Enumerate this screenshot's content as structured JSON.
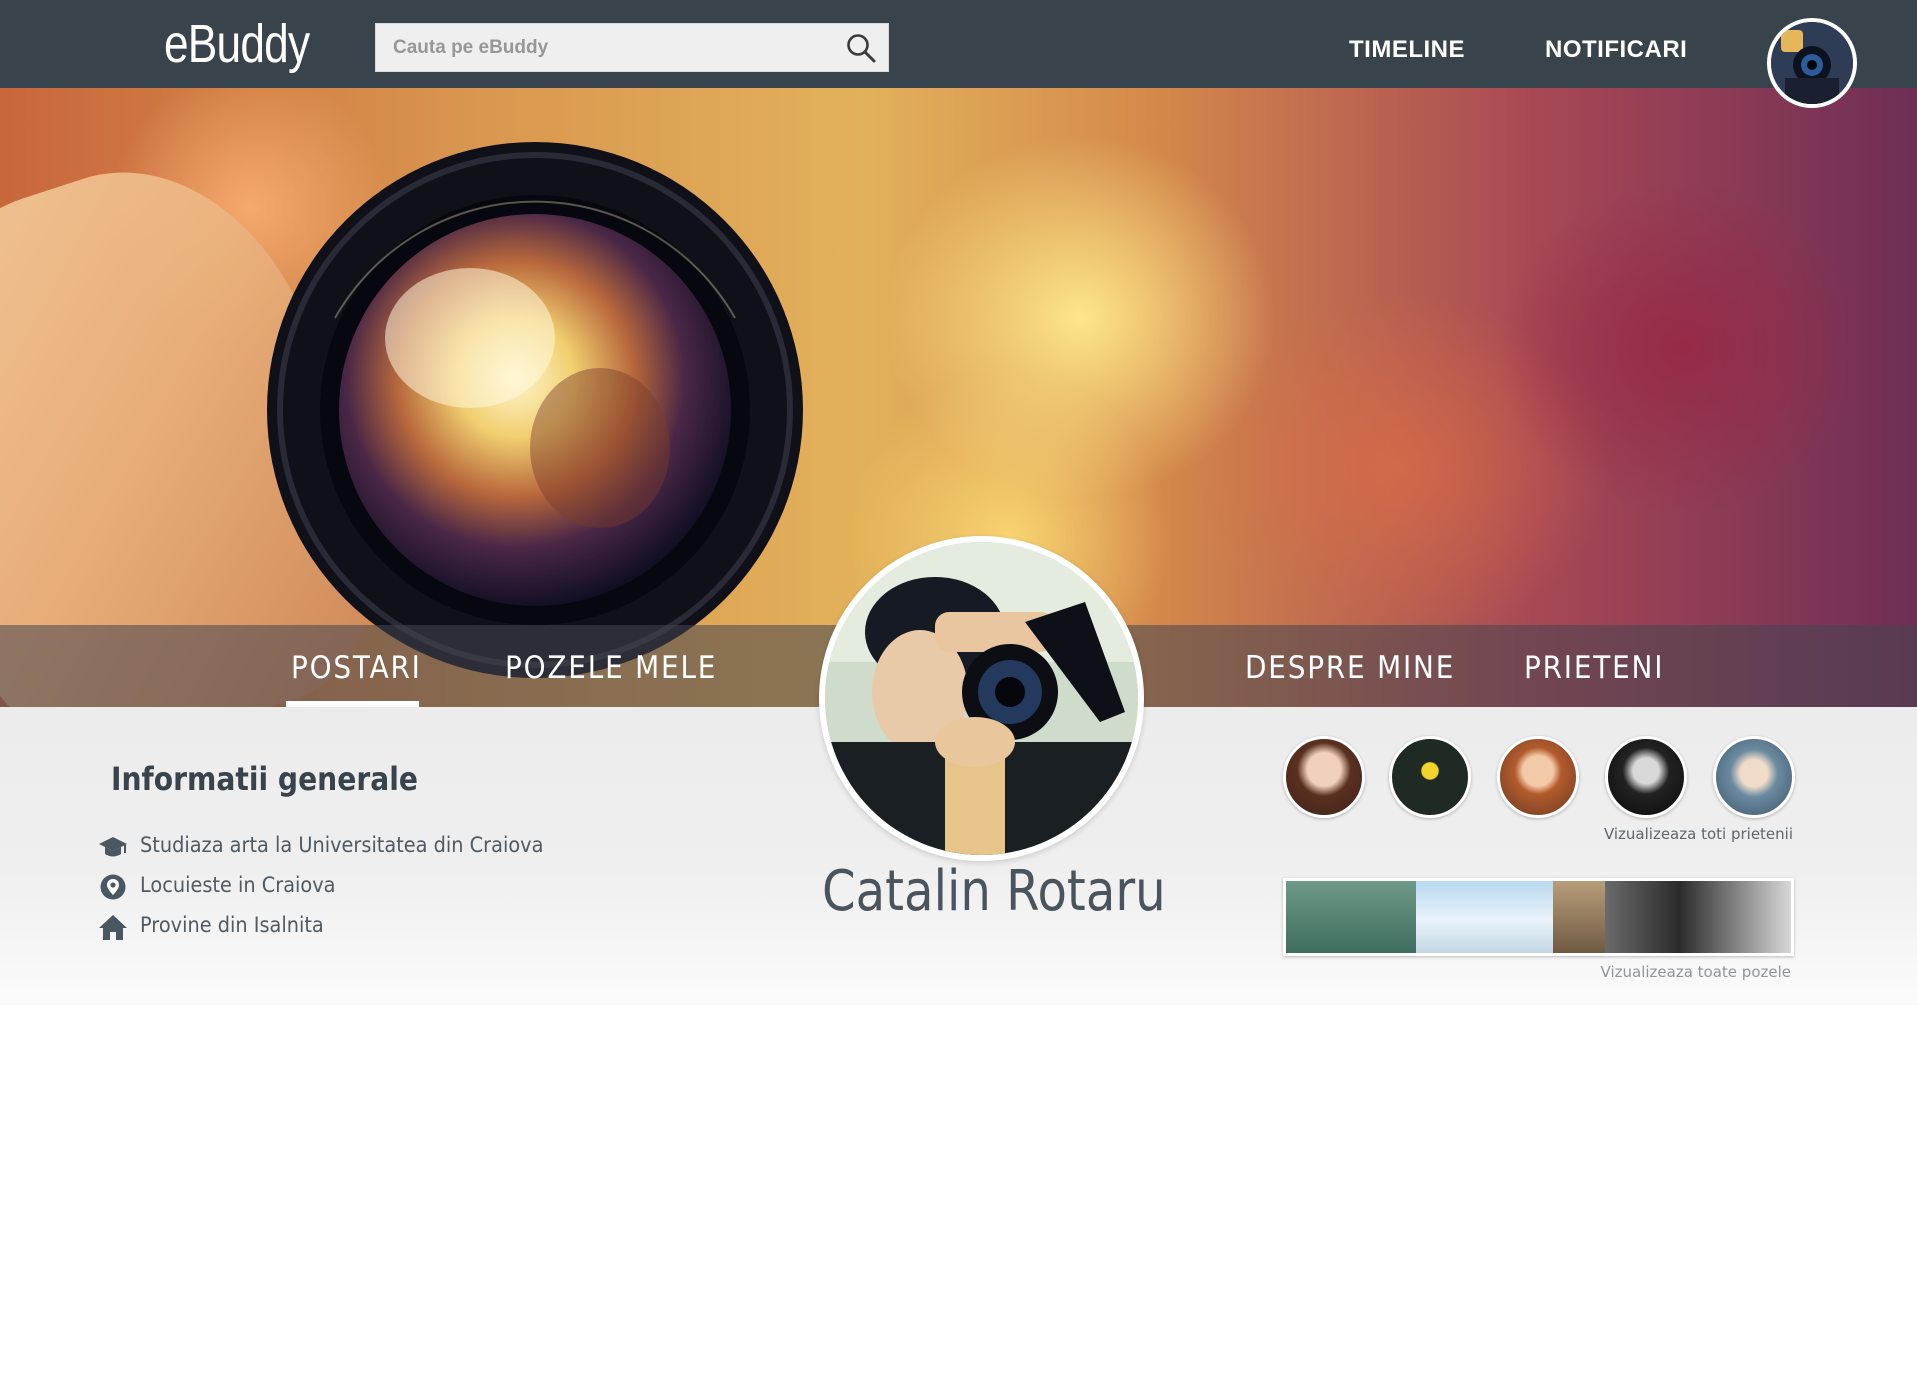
{
  "header": {
    "logo": "eBuddy",
    "search": {
      "placeholder": "Cauta pe eBuddy",
      "value": ""
    },
    "nav": [
      "TIMELINE",
      "NOTIFICARI"
    ]
  },
  "tabs": [
    "POSTARI",
    "POZELE MELE",
    "DESPRE MINE",
    "PRIETENI"
  ],
  "active_tab": "POSTARI",
  "info": {
    "title": "Informatii generale",
    "items": [
      {
        "icon": "graduation-cap-icon",
        "text": "Studiaza arta la Universitatea din Craiova"
      },
      {
        "icon": "location-pin-icon",
        "text": "Locuieste in Craiova"
      },
      {
        "icon": "home-icon",
        "text": "Provine din Isalnita"
      }
    ]
  },
  "profile": {
    "name": "Catalin Rotaru"
  },
  "friends": {
    "view_all": "Vizualizeaza toti prietenii",
    "count_shown": 5
  },
  "photos": {
    "view_all": "Vizualizeaza toate pozele",
    "count_shown": 4
  },
  "colors": {
    "topbar": "#38434c",
    "band": "#eeeeee",
    "text_dark": "#38434c",
    "text_muted": "#5c666f",
    "white": "#ffffff"
  }
}
